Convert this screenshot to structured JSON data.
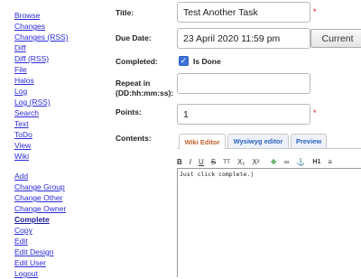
{
  "nav": {
    "group1": [
      "Browse",
      "Changes",
      "Changes (RSS)",
      "Diff",
      "Diff (RSS)",
      "File",
      "Halos",
      "Log",
      "Log (RSS)",
      "Search",
      "Text",
      "ToDo",
      "View",
      "Wiki"
    ],
    "group2": [
      "Add",
      "Change Group",
      "Change Other",
      "Change Owner",
      "Complete",
      "Copy",
      "Edit",
      "Edit Design",
      "Edit User",
      "Logout"
    ],
    "active": "Complete"
  },
  "form": {
    "title_label": "Title:",
    "title_value": "Test Another Task",
    "due_label": "Due Date:",
    "due_value": "23 April 2020 11:59 pm",
    "current_button": "Current",
    "completed_label": "Completed:",
    "completed_checked": true,
    "completed_option": "Is Done",
    "repeat_label_1": "Repeat in",
    "repeat_label_2": "(DD:hh:mm:ss):",
    "repeat_value": "",
    "points_label": "Points:",
    "points_value": "1",
    "contents_label": "Contents:",
    "required_mark": "*"
  },
  "editor": {
    "tabs": [
      "Wiki Editor",
      "Wysiwyg editor",
      "Preview"
    ],
    "active_tab": "Wiki Editor",
    "toolbar": {
      "bold": "B",
      "italic": "I",
      "underline": "U",
      "strike": "S",
      "tt": "TT",
      "sub": "X₂",
      "sup": "X²",
      "h1": "H1"
    },
    "text": "Just click complete."
  }
}
